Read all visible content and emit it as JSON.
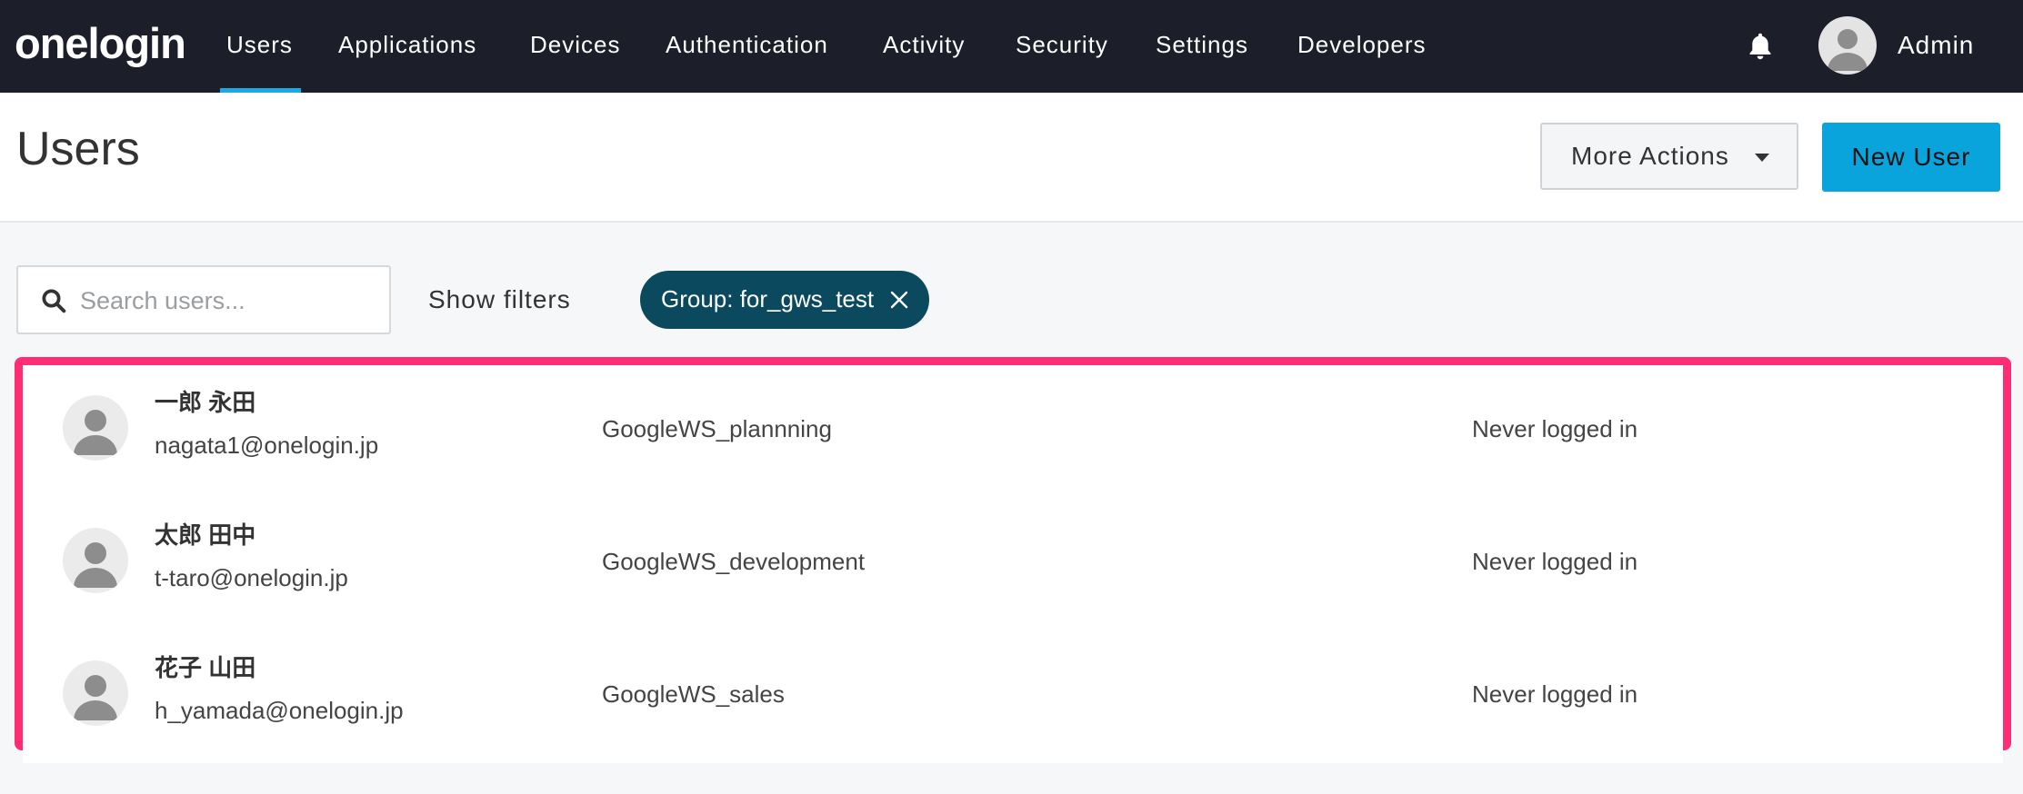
{
  "nav": {
    "logo": "onelogin",
    "items": [
      {
        "label": "Users",
        "active": true
      },
      {
        "label": "Applications"
      },
      {
        "label": "Devices"
      },
      {
        "label": "Authentication"
      },
      {
        "label": "Activity"
      },
      {
        "label": "Security"
      },
      {
        "label": "Settings"
      },
      {
        "label": "Developers"
      }
    ],
    "notifications_icon": "bell-icon",
    "user_label": "Admin"
  },
  "header": {
    "title": "Users",
    "more_actions_label": "More Actions",
    "new_user_label": "New User"
  },
  "filters": {
    "search_placeholder": "Search users...",
    "show_filters_label": "Show filters",
    "active_filter": "Group: for_gws_test"
  },
  "users": [
    {
      "name": "一郎 永田",
      "email": "nagata1@onelogin.jp",
      "group": "GoogleWS_plannning",
      "last_login": "Never logged in"
    },
    {
      "name": "太郎 田中",
      "email": "t-taro@onelogin.jp",
      "group": "GoogleWS_development",
      "last_login": "Never logged in"
    },
    {
      "name": "花子 山田",
      "email": "h_yamada@onelogin.jp",
      "group": "GoogleWS_sales",
      "last_login": "Never logged in"
    }
  ],
  "colors": {
    "nav_bg": "#1c1f2a",
    "accent": "#1ba9e1",
    "primary_button": "#0aa4dc",
    "chip_bg": "#0b4a5e",
    "highlight": "#ff2e74"
  }
}
